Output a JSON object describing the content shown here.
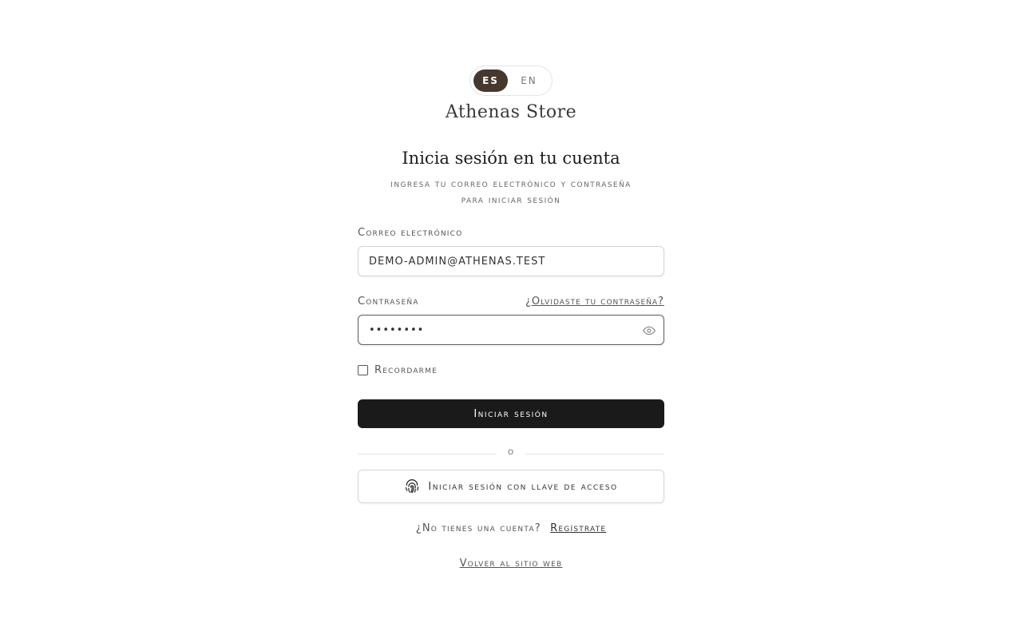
{
  "language_toggle": {
    "es_label": "ES",
    "en_label": "EN",
    "active": "ES"
  },
  "brand": "Athenas Store",
  "heading": {
    "title": "Inicia sesión en tu cuenta",
    "subtitle_line1": "Ingresa tu correo electrónico y contraseña",
    "subtitle_line2": "para iniciar sesión"
  },
  "form": {
    "email_label": "Correo electrónico",
    "email_value": "demo-admin@athenas.test",
    "password_label": "Contraseña",
    "password_value": "••••••••",
    "forgot_link": "¿Olvidaste tu contraseña?",
    "remember_label": "Recordarme",
    "remember_checked": false,
    "submit_label": "Iniciar sesión"
  },
  "divider_text": "o",
  "passkey_button": {
    "label": "Iniciar sesión con llave de acceso",
    "icon": "fingerprint-icon"
  },
  "signup": {
    "prompt": "¿No tienes una cuenta?",
    "link": "Regístrate"
  },
  "back_link": "Volver al sitio web",
  "colors": {
    "accent": "#45392e",
    "primary_button": "#1a1a1a",
    "border": "#d6d6d6"
  }
}
